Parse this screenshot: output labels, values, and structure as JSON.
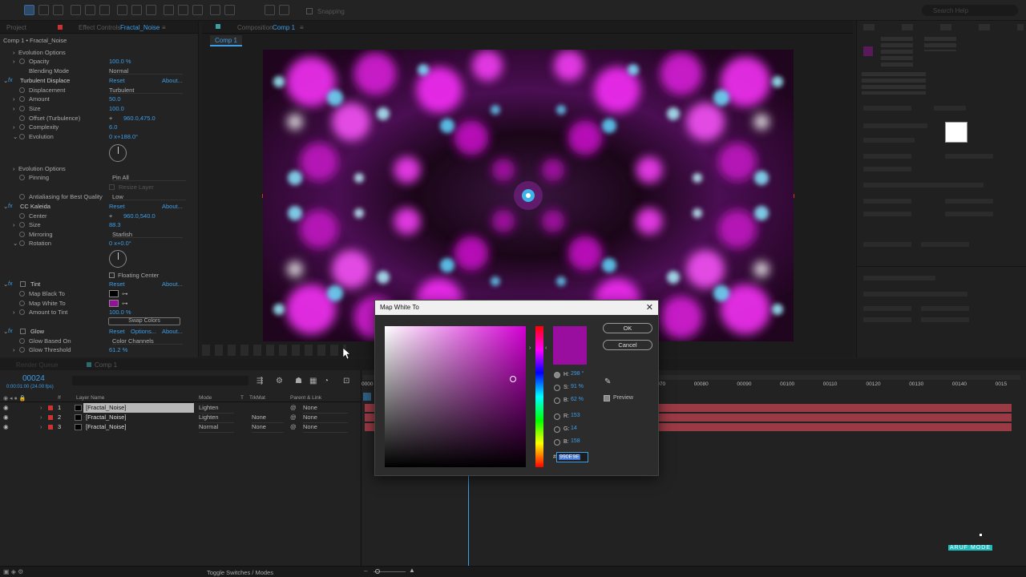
{
  "toolbar": {
    "snapping_label": "Snapping",
    "workspace": "Search Help"
  },
  "left_panel": {
    "tabs": {
      "project": "Project",
      "effect_controls": "Effect Controls",
      "effect_controls_target": "Fractal_Noise"
    },
    "breadcrumb": "Comp 1 • Fractal_Noise",
    "rows": {
      "evolution_options_1": "Evolution Options",
      "opacity_label": "Opacity",
      "opacity_value": "100.0 %",
      "blending_label": "Blending Mode",
      "blending_value": "Normal",
      "td_label": "Turbulent Displace",
      "td_reset": "Reset",
      "td_about": "About...",
      "displacement_label": "Displacement",
      "displacement_value": "Turbulent",
      "amount_label": "Amount",
      "amount_value": "50.0",
      "size_label": "Size",
      "size_value": "100.0",
      "offset_label": "Offset (Turbulence)",
      "offset_value": "960.0,475.0",
      "complexity_label": "Complexity",
      "complexity_value": "6.0",
      "evolution_label": "Evolution",
      "evolution_value": "0 x+188.0°",
      "evolution_options_2": "Evolution Options",
      "pinning_label": "Pinning",
      "pinning_value": "Pin All",
      "resize_layer": "Resize Layer",
      "antialias_label": "Antialiasing for Best Quality",
      "antialias_value": "Low",
      "cck_label": "CC Kaleida",
      "cck_reset": "Reset",
      "cck_about": "About...",
      "center_label": "Center",
      "center_value": "960.0,540.0",
      "ksize_label": "Size",
      "ksize_value": "88.3",
      "mirroring_label": "Mirroring",
      "mirroring_value": "Starlish",
      "rotation_label": "Rotation",
      "rotation_value": "0 x+0.0°",
      "floating_center": "Floating Center",
      "tint_label": "Tint",
      "tint_reset": "Reset",
      "tint_about": "About...",
      "map_black_label": "Map Black To",
      "map_white_label": "Map White To",
      "amount_tint_label": "Amount to Tint",
      "amount_tint_value": "100.0 %",
      "swap_colors": "Swap Colors",
      "glow_label": "Glow",
      "glow_reset": "Reset",
      "glow_options": "Options...",
      "glow_about": "About...",
      "glow_based_label": "Glow Based On",
      "glow_based_value": "Color Channels",
      "glow_threshold_label": "Glow Threshold",
      "glow_threshold_value": "61.2 %"
    }
  },
  "viewer": {
    "tab_label": "Composition",
    "tab_comp": "Comp 1",
    "subtab": "Comp 1"
  },
  "colors": {
    "map_black": "#000000",
    "map_white": "#990E9E",
    "accent": "#3d9ee8",
    "layer_bar": "#9a3a45"
  },
  "timeline": {
    "render_queue": "Render Queue",
    "comp_tab": "Comp 1",
    "timecode": "00024",
    "timecode_sub": "0:00:01:00 (24.00 fps)",
    "headers": {
      "layer_name": "Layer Name",
      "mode": "Mode",
      "t": "T",
      "trkmat": "TrkMat",
      "parent": "Parent & Link"
    },
    "layers": [
      {
        "num": "1",
        "name": "[Fractal_Noise]",
        "mode": "Lighten",
        "trkmat": "",
        "parent": "None"
      },
      {
        "num": "2",
        "name": "[Fractal_Noise]",
        "mode": "Lighten",
        "trkmat": "None",
        "parent": "None"
      },
      {
        "num": "3",
        "name": "[Fractal_Noise]",
        "mode": "Normal",
        "trkmat": "None",
        "parent": "None"
      }
    ],
    "ruler": [
      "00070",
      "00080",
      "00090",
      "00100",
      "00110",
      "00120",
      "00130",
      "00140",
      "0015"
    ],
    "ruler_start": "0000"
  },
  "status": {
    "toggle": "Toggle Switches / Modes"
  },
  "dialog": {
    "title": "Map White To",
    "ok": "OK",
    "cancel": "Cancel",
    "h_label": "H:",
    "h_value": "298 °",
    "s_label": "S:",
    "s_value": "91 %",
    "b_label": "B:",
    "b_value": "62 %",
    "r_label": "R:",
    "r_value": "153",
    "g_label": "G:",
    "g_value": "14",
    "bb_label": "B:",
    "bb_value": "158",
    "hash": "#",
    "hex": "990E9E",
    "preview": "Preview"
  },
  "watermark": "ARUF MODE"
}
